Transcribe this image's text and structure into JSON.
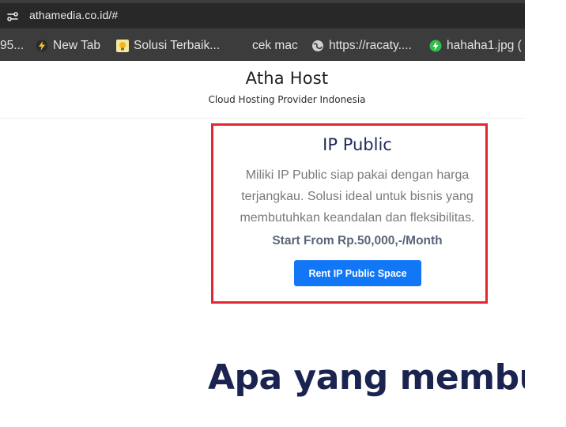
{
  "browser": {
    "url": "athamedia.co.id/#",
    "bookmarks": [
      {
        "label": "95...",
        "icon": "none"
      },
      {
        "label": "New Tab",
        "icon": "lightning-icon"
      },
      {
        "label": "Solusi Terbaik...",
        "icon": "lightbulb-icon"
      },
      {
        "label": "cek mac",
        "icon": "none"
      },
      {
        "label": "https://racaty....",
        "icon": "globe-icon"
      },
      {
        "label": "hahaha1.jpg (",
        "icon": "green-bolt-icon"
      }
    ]
  },
  "header": {
    "title": "Atha Host",
    "subtitle": "Cloud Hosting Provider Indonesia"
  },
  "card": {
    "title": "IP Public",
    "description": "Miliki IP Public siap pakai dengan harga terjangkau. Solusi ideal untuk bisnis yang membutuhkan keandalan dan fleksibilitas.",
    "price": "Start From Rp.50,000,-/Month",
    "button_label": "Rent IP Public Space"
  },
  "section": {
    "heading": "Apa yang membuat"
  },
  "colors": {
    "highlight": "#e3262f",
    "button": "#1277f6",
    "title_navy": "#1e2a5a"
  }
}
